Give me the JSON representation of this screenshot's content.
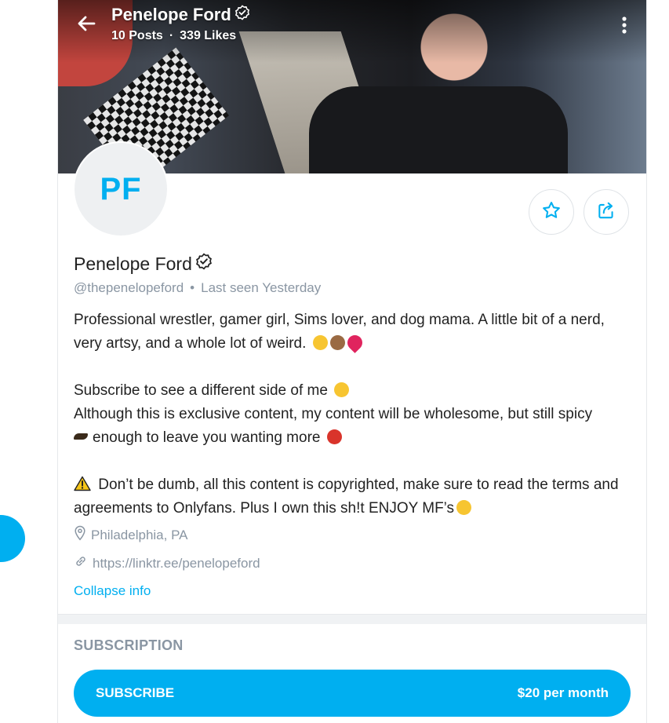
{
  "header": {
    "name": "Penelope Ford",
    "posts": "10 Posts",
    "likes": "339 Likes"
  },
  "avatar": {
    "initials": "PF"
  },
  "profile": {
    "name": "Penelope Ford",
    "handle": "@thepenelopeford",
    "last_seen": "Last seen Yesterday"
  },
  "bio": {
    "line1": "Professional wrestler, gamer girl, Sims lover, and dog mama. A little bit of a nerd, very artsy, and a whole lot of weird.",
    "line2": "Subscribe to see a different side of me",
    "line3a": "Although this is exclusive content, my content will be wholesome, but still spicy",
    "line3b": "enough to leave you wanting more",
    "line4": "Don’t be dumb, all this content is copyrighted, make sure to read the terms and agreements to Onlyfans. Plus I own this sh!t ENJOY MF’s"
  },
  "info": {
    "location": "Philadelphia, PA",
    "link": "https://linktr.ee/penelopeford",
    "collapse": "Collapse info"
  },
  "subscription": {
    "title": "SUBSCRIPTION",
    "button_label": "SUBSCRIBE",
    "price": "$20 per month"
  },
  "colors": {
    "accent": "#00aff0",
    "muted": "#8a96a3"
  }
}
